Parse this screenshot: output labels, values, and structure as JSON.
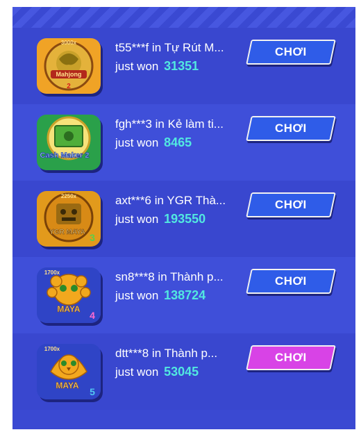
{
  "colors": {
    "panel": "#3a49d2",
    "amount": "#52e8e0",
    "button": "#2f5ce8",
    "button_active": "#d843e6"
  },
  "wins": [
    {
      "title": "t55***f in Tự Rút M...",
      "won_label": "just won",
      "amount": "31351",
      "button": "CHƠI",
      "game_icon": "mahjong-game-icon",
      "badge": "3000x",
      "logo": "Mahjong"
    },
    {
      "title": "fgh***3 in Kẻ làm ti...",
      "won_label": "just won",
      "amount": "8465",
      "button": "CHƠI",
      "game_icon": "cash-maker-2-game-icon",
      "badge": "",
      "logo": "Cash Maker 2"
    },
    {
      "title": "axt***6 in YGR Thà...",
      "won_label": "just won",
      "amount": "193550",
      "button": "CHƠI",
      "game_icon": "ygr-maya-3-game-icon",
      "badge": "2250x",
      "logo": "YGR MAYA"
    },
    {
      "title": "sn8***8 in Thành p...",
      "won_label": "just won",
      "amount": "138724",
      "button": "CHƠI",
      "game_icon": "maya-golden-city-4-game-icon",
      "badge": "1700x",
      "logo": "MAYA"
    },
    {
      "title": "dtt***8 in Thành p...",
      "won_label": "just won",
      "amount": "53045",
      "button": "CHƠI",
      "game_icon": "maya-golden-city-5-game-icon",
      "badge": "1700x",
      "logo": "MAYA"
    }
  ]
}
